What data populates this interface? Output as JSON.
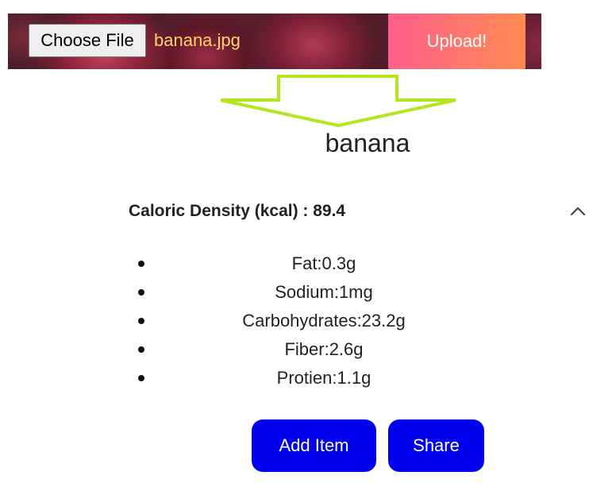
{
  "upload": {
    "choose_label": "Choose File",
    "file_name": "banana.jpg",
    "upload_label": "Upload!"
  },
  "result": {
    "food_name": "banana",
    "caloric_density": "Caloric Density (kcal) : 89.4",
    "nutrients": [
      "Fat:0.3g",
      "Sodium:1mg",
      "Carbohydrates:23.2g",
      "Fiber:2.6g",
      "Protien:1.1g"
    ]
  },
  "actions": {
    "add_label": "Add Item",
    "share_label": "Share"
  },
  "colors": {
    "arrow": "#b5e61d",
    "action_buttons": "#0000ee",
    "file_name": "#ffd36b",
    "upload_gradient_start": "#ff5e8a",
    "upload_gradient_end": "#ff8a50"
  },
  "icons": {
    "arrow": "down-arrow-icon",
    "collapse": "chevron-up-icon"
  }
}
